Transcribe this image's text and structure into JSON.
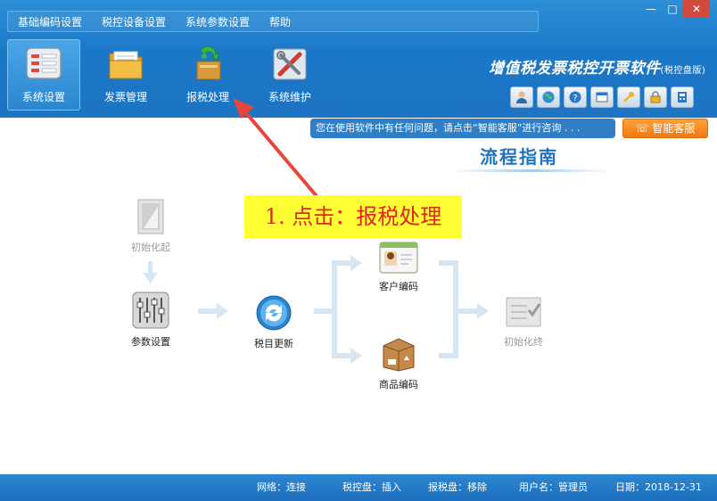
{
  "menu": [
    "基础编码设置",
    "税控设备设置",
    "系统参数设置",
    "帮助"
  ],
  "window_controls": {
    "minimize": "—",
    "maximize": "□",
    "close": "✕"
  },
  "toolbar": [
    {
      "label": "系统设置",
      "icon": "settings-panel-icon",
      "active": true
    },
    {
      "label": "发票管理",
      "icon": "folder-icon",
      "active": false
    },
    {
      "label": "报税处理",
      "icon": "tax-report-icon",
      "active": false
    },
    {
      "label": "系统维护",
      "icon": "tools-icon",
      "active": false
    }
  ],
  "brand": {
    "title": "增值税发票税控开票软件",
    "subtitle": "(税控盘版)"
  },
  "quick_icons": [
    "user-icon",
    "globe-icon",
    "help-icon",
    "window-icon",
    "key-icon",
    "lock-icon",
    "calculator-icon"
  ],
  "notice": "您在使用软件中有任何问题，请点击“智能客服”进行咨询 . . .",
  "service_button": "智能客服",
  "flow_title": "流程指南",
  "annotation": "1. 点击：报税处理",
  "flow": {
    "init_start": "初始化起",
    "param_settings": "参数设置",
    "tax_update": "税目更新",
    "customer_code": "客户编码",
    "product_code": "商品编码",
    "init_end": "初始化终"
  },
  "status": {
    "network": "网络：连接",
    "tax_disk": "税控盘：插入",
    "report_disk": "报税盘：移除",
    "username": "用户名：管理员",
    "date": "日期：2018-12-31"
  },
  "colors": {
    "chrome": "#1b78c8",
    "annotation_bg": "#ffff33",
    "annotation_text": "#e0261a",
    "arrow": "#e8453c",
    "service": "#f07a12"
  }
}
